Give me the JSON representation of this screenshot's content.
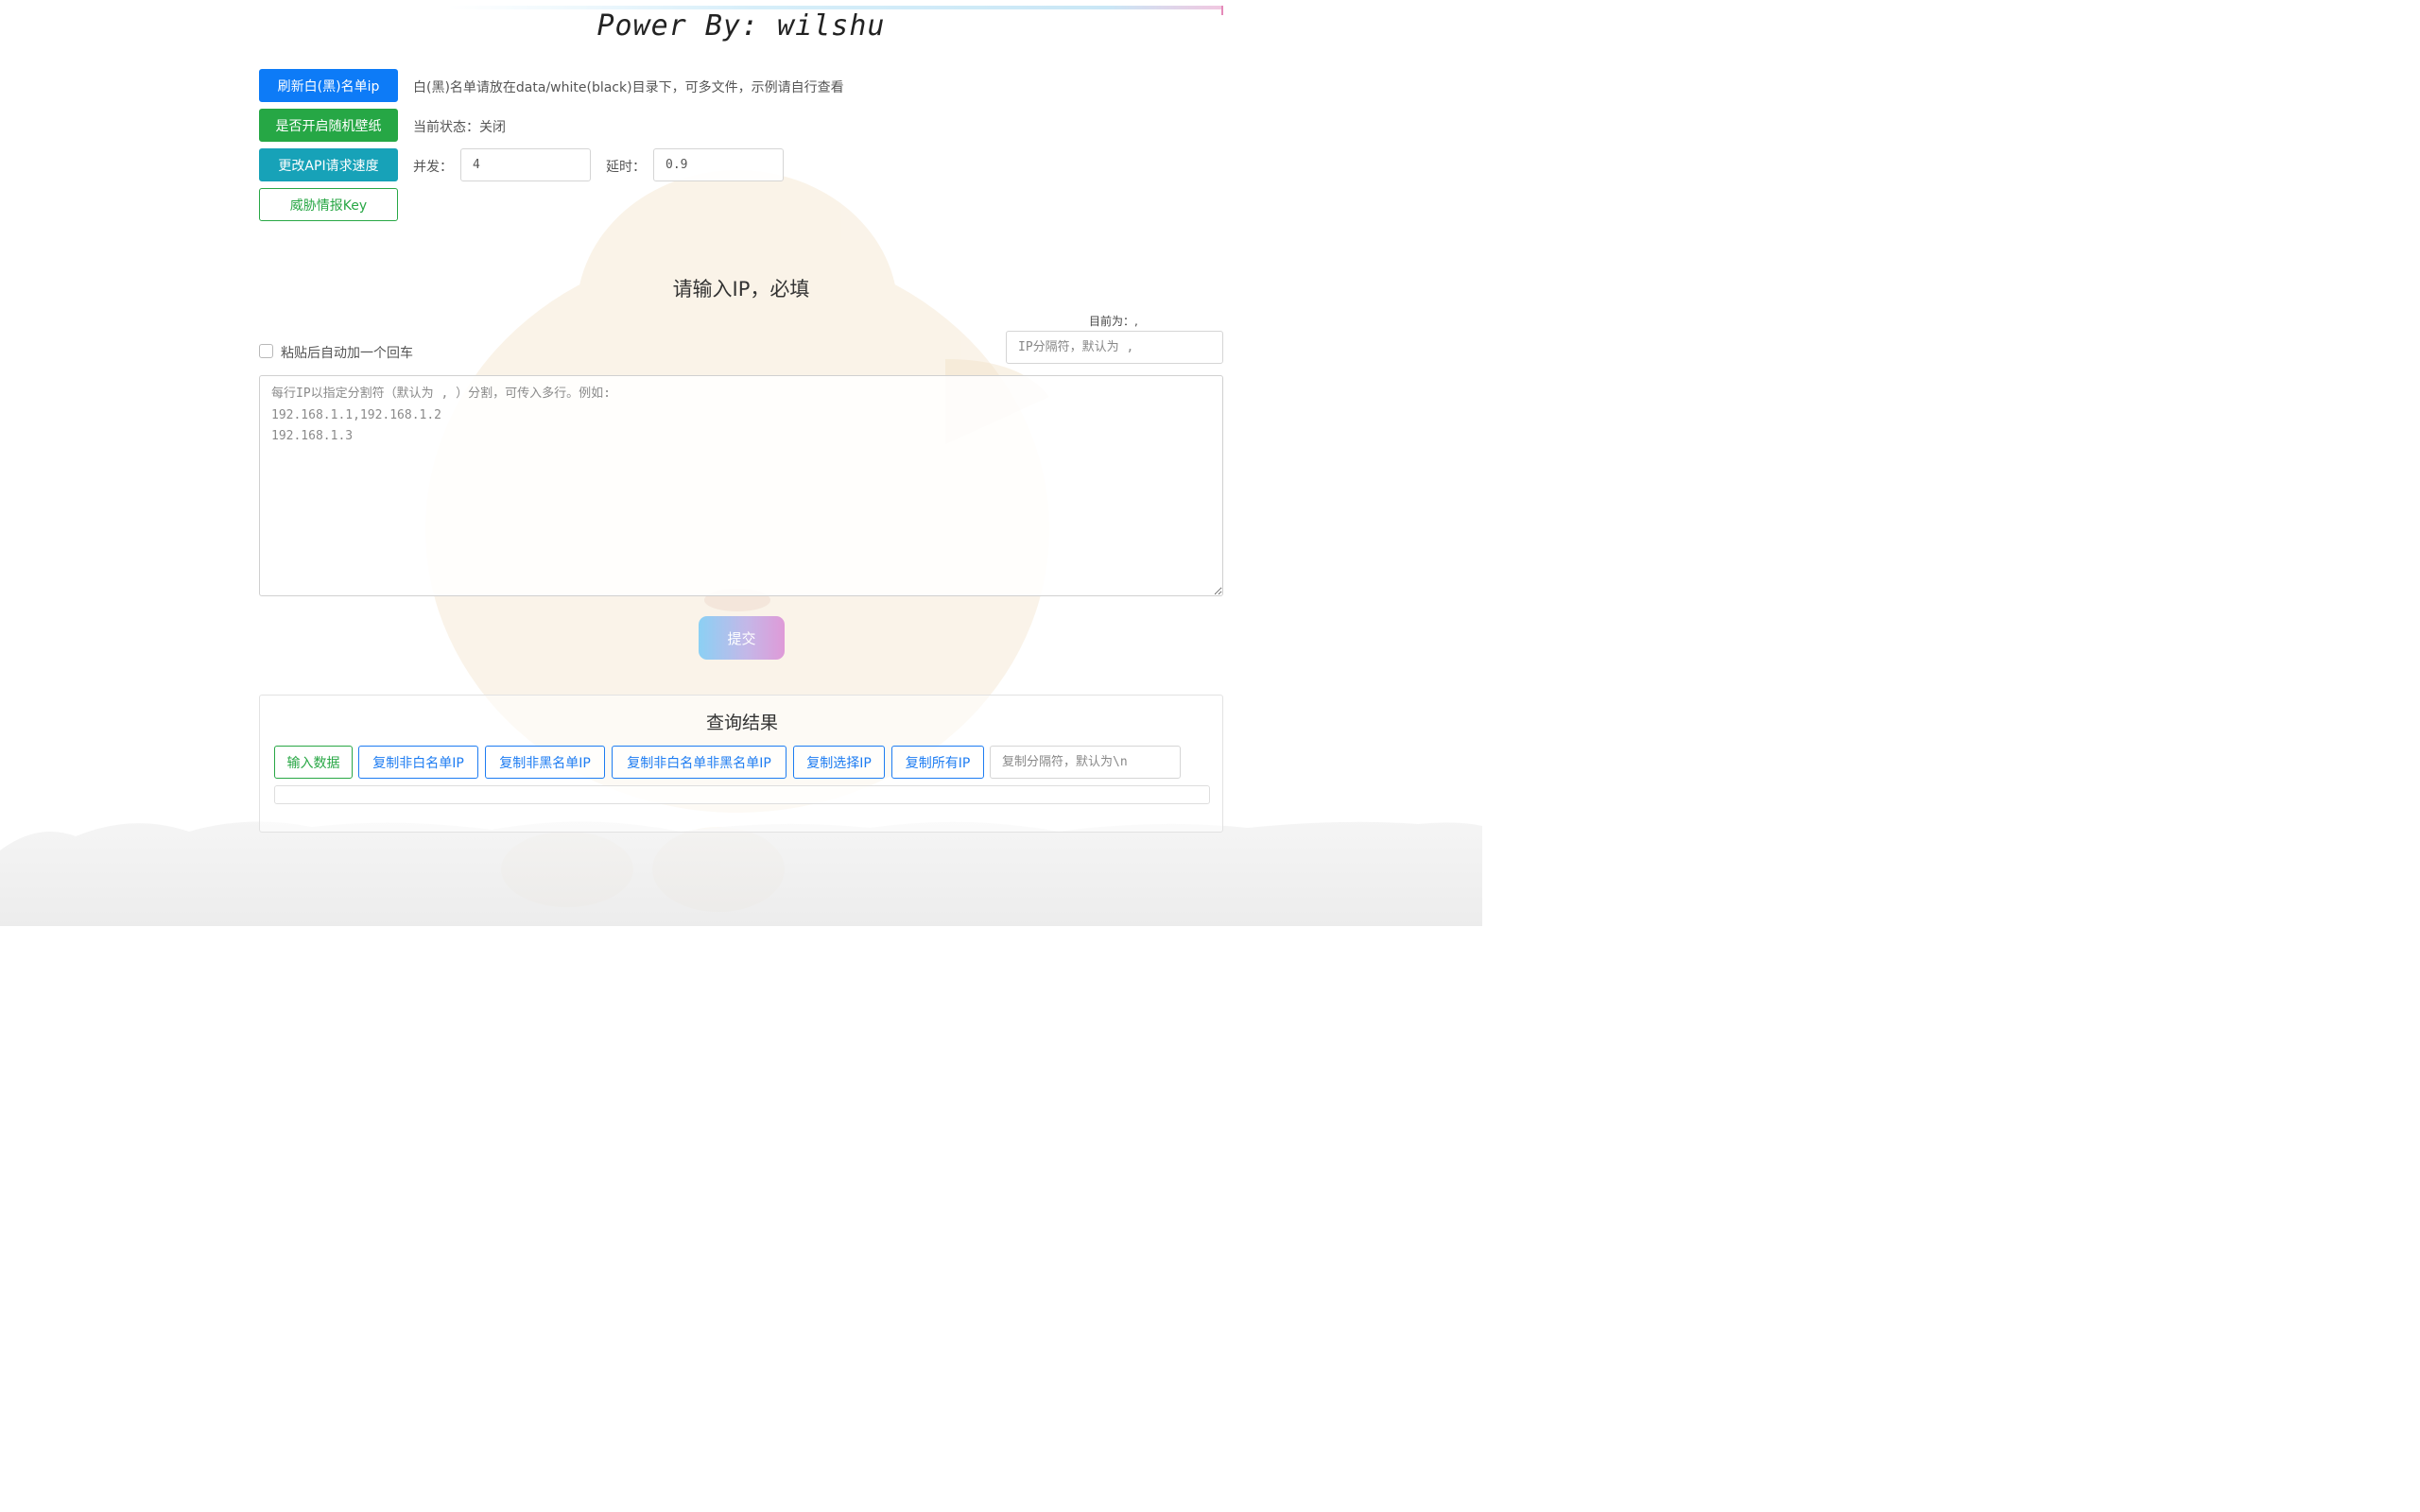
{
  "header": {
    "title": "Power By: wilshu"
  },
  "controls": {
    "refresh_list_button": "刷新白(黑)名单ip",
    "refresh_list_hint": "白(黑)名单请放在data/white(black)目录下，可多文件，示例请自行查看",
    "wallpaper_button": "是否开启随机壁纸",
    "wallpaper_status": "当前状态：关闭",
    "speed_button": "更改API请求速度",
    "concurrency_label": "并发：",
    "concurrency_value": "4",
    "delay_label": "延时：",
    "delay_value": "0.9",
    "threat_key_button": "威胁情报Key"
  },
  "input_section": {
    "title": "请输入IP，必填",
    "separator_current": "目前为：,",
    "separator_placeholder": "IP分隔符，默认为 ,",
    "auto_enter_label": "粘贴后自动加一个回车",
    "auto_enter_checked": false,
    "textarea_placeholder": "每行IP以指定分割符（默认为 , ）分割，可传入多行。例如:\n192.168.1.1,192.168.1.2\n192.168.1.3",
    "submit_label": "提交"
  },
  "results": {
    "title": "查询结果",
    "buttons": {
      "input_data": "输入数据",
      "copy_non_white": "复制非白名单IP",
      "copy_non_black": "复制非黑名单IP",
      "copy_non_white_non_black": "复制非白名单非黑名单IP",
      "copy_selected": "复制选择IP",
      "copy_all": "复制所有IP"
    },
    "copy_separator_placeholder": "复制分隔符，默认为\\n"
  },
  "colors": {
    "primary": "#0d7bf7",
    "success": "#26a745",
    "info": "#17a2b8"
  },
  "background": {
    "image": "cat-wallpaper"
  }
}
